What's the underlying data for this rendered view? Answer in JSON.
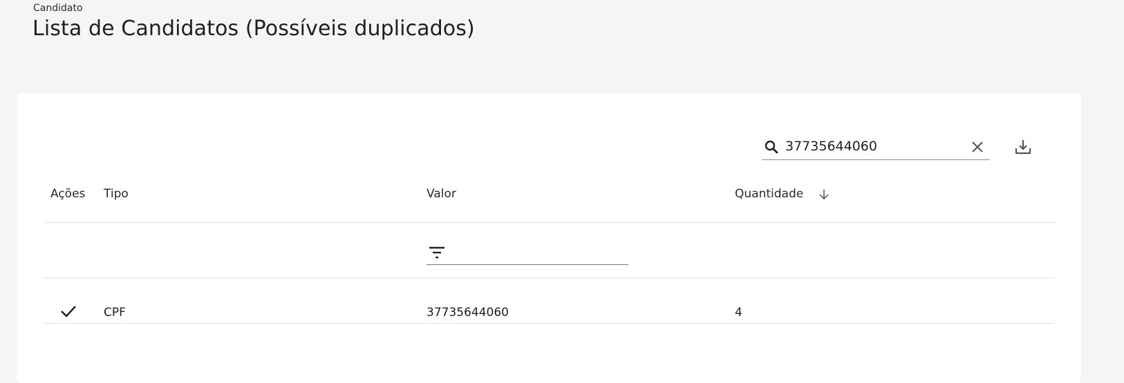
{
  "header": {
    "breadcrumb": "Candidato",
    "title": "Lista de Candidatos (Possíveis duplicados)"
  },
  "toolbar": {
    "search_value": "37735644060",
    "search_icon": "search-icon",
    "clear_icon": "close-icon",
    "download_icon": "download-icon"
  },
  "table": {
    "columns": [
      "Ações",
      "Tipo",
      "Valor",
      "Quantidade"
    ],
    "sort": {
      "column": "Quantidade",
      "direction": "desc",
      "icon": "arrow-down-icon"
    },
    "filter": {
      "column": "Valor",
      "icon": "filter-icon",
      "value": ""
    },
    "rows": [
      {
        "action_icon": "check-icon",
        "tipo": "CPF",
        "valor": "37735644060",
        "quantidade": "4"
      }
    ]
  },
  "colors": {
    "background": "#f4f5f7",
    "card": "#ffffff",
    "text": "#1f1f1f",
    "divider": "#e1e1e1"
  }
}
